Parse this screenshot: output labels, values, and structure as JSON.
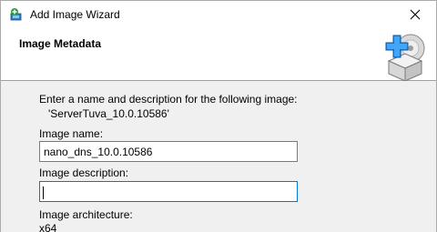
{
  "window": {
    "title": "Add Image Wizard",
    "close_glyph": "✕"
  },
  "header": {
    "title": "Image Metadata"
  },
  "content": {
    "instruction": "Enter a name and description for the following image:",
    "image_source": "'ServerTuva_10.0.10586'",
    "name_label": "Image name:",
    "name_value": "nano_dns_10.0.10586",
    "description_label": "Image description:",
    "description_value": "",
    "architecture_label": "Image architecture:",
    "architecture_value": "x64"
  },
  "icons": {
    "app": "wizard-app-icon",
    "close": "close-icon",
    "graphic": "add-image-disc-icon"
  }
}
